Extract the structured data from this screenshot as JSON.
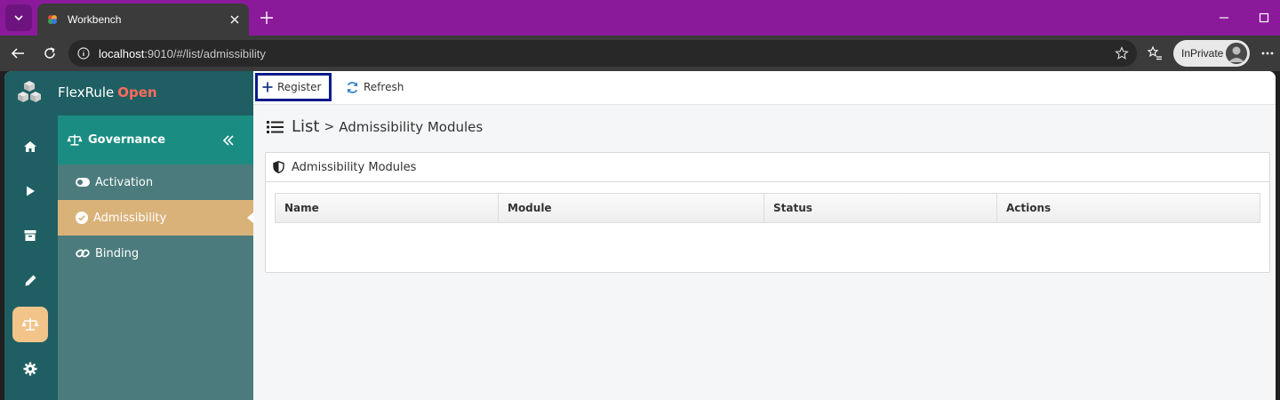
{
  "browser": {
    "tab_title": "Workbench",
    "url_host": "localhost",
    "url_path": ":9010/#/list/admissibility",
    "inprivate_label": "InPrivate"
  },
  "app": {
    "brand_name": "FlexRule",
    "brand_suffix": "Open",
    "colors": {
      "brand_dark": "#1f5f63",
      "accent_teal": "#1b8c82",
      "active_item": "#d9b27a",
      "brand_red": "#ff6b5a"
    }
  },
  "iconbar": {
    "items": [
      {
        "icon": "home-icon"
      },
      {
        "icon": "play-icon"
      },
      {
        "icon": "archive-icon"
      },
      {
        "icon": "pencil-icon"
      },
      {
        "icon": "scale-icon",
        "active": true
      },
      {
        "icon": "gear-icon"
      }
    ]
  },
  "subnav": {
    "title": "Governance",
    "items": [
      {
        "label": "Activation",
        "icon": "toggle-icon"
      },
      {
        "label": "Admissibility",
        "icon": "check-circle-icon",
        "active": true
      },
      {
        "label": "Binding",
        "icon": "link-icon"
      }
    ]
  },
  "toolbar": {
    "register_label": "Register",
    "refresh_label": "Refresh"
  },
  "breadcrumb": {
    "root": "List",
    "separator": ">",
    "page": "Admissibility Modules"
  },
  "panel": {
    "title": "Admissibility Modules",
    "columns": [
      "Name",
      "Module",
      "Status",
      "Actions"
    ]
  }
}
